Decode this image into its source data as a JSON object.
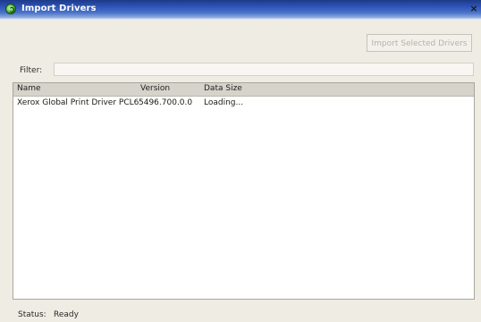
{
  "window": {
    "title": "Import Drivers",
    "close_glyph": "×"
  },
  "toolbar": {
    "import_label": "Import Selected Drivers"
  },
  "filter": {
    "label": "Filter:",
    "value": ""
  },
  "table": {
    "columns": [
      "Name",
      "Version",
      "Data Size"
    ],
    "rows": [
      [
        "Xerox Global Print Driver PCL6",
        "5496.700.0.0",
        "Loading..."
      ]
    ]
  },
  "status": {
    "label": "Status:",
    "value": "Ready"
  },
  "icons": {
    "app": "refresh-globe-icon",
    "close": "close-icon"
  },
  "colors": {
    "titlebar": "#2e55b8",
    "window": "#efece3",
    "list_header": "#d6d3cb"
  }
}
